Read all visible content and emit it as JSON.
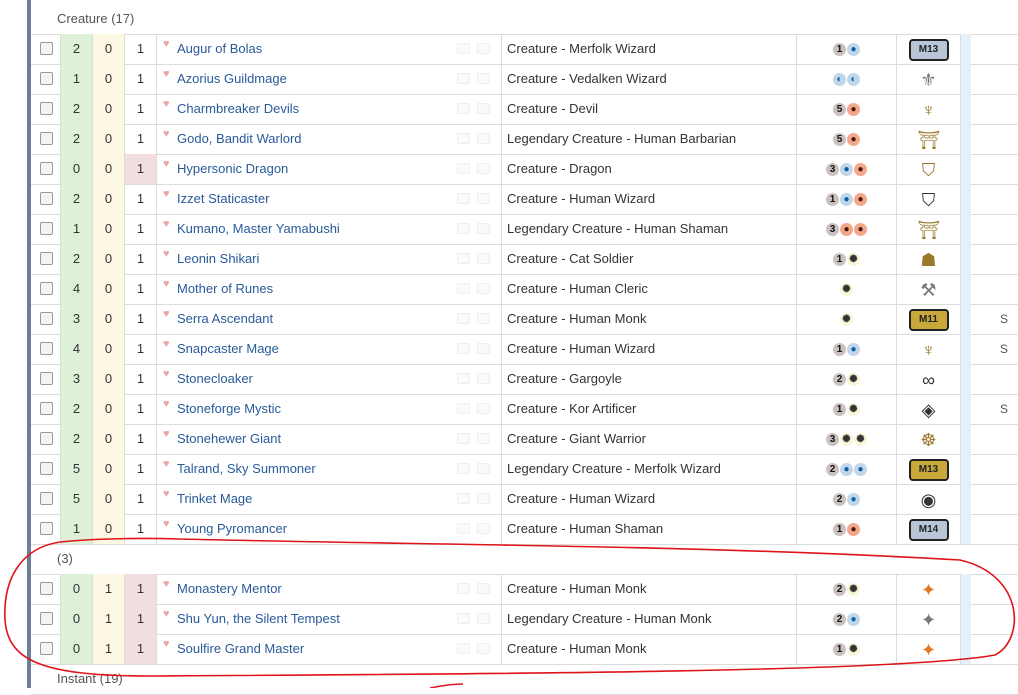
{
  "groups": [
    {
      "label": "Creature (17)",
      "rows": [
        {
          "a": "2",
          "b": "0",
          "c": "1",
          "name": "Augur of Bolas",
          "type": "Creature - Merfolk Wizard",
          "cost": [
            "1",
            "U"
          ],
          "set": {
            "kind": "core",
            "text": "M13",
            "tone": "silver"
          }
        },
        {
          "a": "1",
          "b": "0",
          "c": "1",
          "name": "Azorius Guildmage",
          "type": "Creature - Vedalken Wizard",
          "cost": [
            "W/U",
            "W/U"
          ],
          "set": {
            "kind": "symbol",
            "icon": "azorius-guild-icon",
            "glyph": "⚜",
            "tone": "grey"
          }
        },
        {
          "a": "2",
          "b": "0",
          "c": "1",
          "name": "Charmbreaker Devils",
          "type": "Creature - Devil",
          "cost": [
            "5",
            "R"
          ],
          "set": {
            "kind": "symbol",
            "icon": "bat-wing-icon",
            "glyph": "♆",
            "tone": "gold"
          }
        },
        {
          "a": "2",
          "b": "0",
          "c": "1",
          "name": "Godo, Bandit Warlord",
          "type": "Legendary Creature - Human Barbarian",
          "cost": [
            "5",
            "R"
          ],
          "set": {
            "kind": "symbol",
            "icon": "torii-gate-icon",
            "glyph": "⛩",
            "tone": "gold"
          }
        },
        {
          "a": "0",
          "b": "0",
          "c": "1",
          "pink": true,
          "name": "Hypersonic Dragon",
          "type": "Creature - Dragon",
          "cost": [
            "3",
            "U",
            "R"
          ],
          "set": {
            "kind": "symbol",
            "icon": "shield-crest-icon",
            "glyph": "⛉",
            "tone": "gold"
          }
        },
        {
          "a": "2",
          "b": "0",
          "c": "1",
          "name": "Izzet Staticaster",
          "type": "Creature - Human Wizard",
          "cost": [
            "1",
            "U",
            "R"
          ],
          "set": {
            "kind": "symbol",
            "icon": "shield-crest-icon",
            "glyph": "⛉",
            "tone": "dark"
          }
        },
        {
          "a": "1",
          "b": "0",
          "c": "1",
          "name": "Kumano, Master Yamabushi",
          "type": "Legendary Creature - Human Shaman",
          "cost": [
            "3",
            "R",
            "R"
          ],
          "set": {
            "kind": "symbol",
            "icon": "torii-gate-icon",
            "glyph": "⛩",
            "tone": "gold"
          }
        },
        {
          "a": "2",
          "b": "0",
          "c": "1",
          "name": "Leonin Shikari",
          "type": "Creature - Cat Soldier",
          "cost": [
            "1",
            "W"
          ],
          "set": {
            "kind": "symbol",
            "icon": "mask-icon",
            "glyph": "☗",
            "tone": "gold"
          }
        },
        {
          "a": "4",
          "b": "0",
          "c": "1",
          "name": "Mother of Runes",
          "type": "Creature - Human Cleric",
          "cost": [
            "W"
          ],
          "set": {
            "kind": "symbol",
            "icon": "hammer-icon",
            "glyph": "⚒",
            "tone": "grey"
          }
        },
        {
          "a": "3",
          "b": "0",
          "c": "1",
          "name": "Serra Ascendant",
          "type": "Creature - Human Monk",
          "cost": [
            "W"
          ],
          "set": {
            "kind": "core",
            "text": "M11",
            "tone": "gold"
          }
        },
        {
          "a": "4",
          "b": "0",
          "c": "1",
          "name": "Snapcaster Mage",
          "type": "Creature - Human Wizard",
          "cost": [
            "1",
            "U"
          ],
          "set": {
            "kind": "symbol",
            "icon": "bat-wing-icon",
            "glyph": "♆",
            "tone": "gold"
          }
        },
        {
          "a": "3",
          "b": "0",
          "c": "1",
          "name": "Stonecloaker",
          "type": "Creature - Gargoyle",
          "cost": [
            "2",
            "W"
          ],
          "set": {
            "kind": "symbol",
            "icon": "chain-link-icon",
            "glyph": "∞",
            "tone": "dark"
          }
        },
        {
          "a": "2",
          "b": "0",
          "c": "1",
          "name": "Stoneforge Mystic",
          "type": "Creature - Kor Artificer",
          "cost": [
            "1",
            "W"
          ],
          "set": {
            "kind": "symbol",
            "icon": "diamond-crest-icon",
            "glyph": "◈",
            "tone": "dark"
          }
        },
        {
          "a": "2",
          "b": "0",
          "c": "1",
          "name": "Stonehewer Giant",
          "type": "Creature - Giant Warrior",
          "cost": [
            "3",
            "W",
            "W"
          ],
          "set": {
            "kind": "symbol",
            "icon": "swirl-icon",
            "glyph": "☸",
            "tone": "gold"
          }
        },
        {
          "a": "5",
          "b": "0",
          "c": "1",
          "name": "Talrand, Sky Summoner",
          "type": "Legendary Creature - Merfolk Wizard",
          "cost": [
            "2",
            "U",
            "U"
          ],
          "set": {
            "kind": "core",
            "text": "M13",
            "tone": "gold"
          }
        },
        {
          "a": "5",
          "b": "0",
          "c": "1",
          "name": "Trinket Mage",
          "type": "Creature - Human Wizard",
          "cost": [
            "2",
            "U"
          ],
          "set": {
            "kind": "symbol",
            "icon": "eye-orb-icon",
            "glyph": "◉",
            "tone": "dark"
          }
        },
        {
          "a": "1",
          "b": "0",
          "c": "1",
          "name": "Young Pyromancer",
          "type": "Creature - Human Shaman",
          "cost": [
            "1",
            "R"
          ],
          "set": {
            "kind": "core",
            "text": "M14",
            "tone": "silver"
          }
        }
      ]
    },
    {
      "label": "(3)",
      "rows": [
        {
          "a": "0",
          "b": "1",
          "c": "1",
          "pink": true,
          "name": "Monastery Mentor",
          "type": "Creature - Human Monk",
          "cost": [
            "2",
            "W"
          ],
          "set": {
            "kind": "symbol",
            "icon": "fate-reforged-icon",
            "glyph": "✦",
            "tone": "orange"
          }
        },
        {
          "a": "0",
          "b": "1",
          "c": "1",
          "pink": true,
          "name": "Shu Yun, the Silent Tempest",
          "type": "Legendary Creature - Human Monk",
          "cost": [
            "2",
            "U"
          ],
          "set": {
            "kind": "symbol",
            "icon": "fate-reforged-icon",
            "glyph": "✦",
            "tone": "grey"
          }
        },
        {
          "a": "0",
          "b": "1",
          "c": "1",
          "pink": true,
          "name": "Soulfire Grand Master",
          "type": "Creature - Human Monk",
          "cost": [
            "1",
            "W"
          ],
          "set": {
            "kind": "symbol",
            "icon": "fate-reforged-icon",
            "glyph": "✦",
            "tone": "orange"
          }
        }
      ]
    }
  ],
  "next_group_label": "Instant (19)",
  "edge_letter": "S",
  "colors": {
    "annotation": "#e0141b",
    "leftbar": "#6b7f95"
  }
}
